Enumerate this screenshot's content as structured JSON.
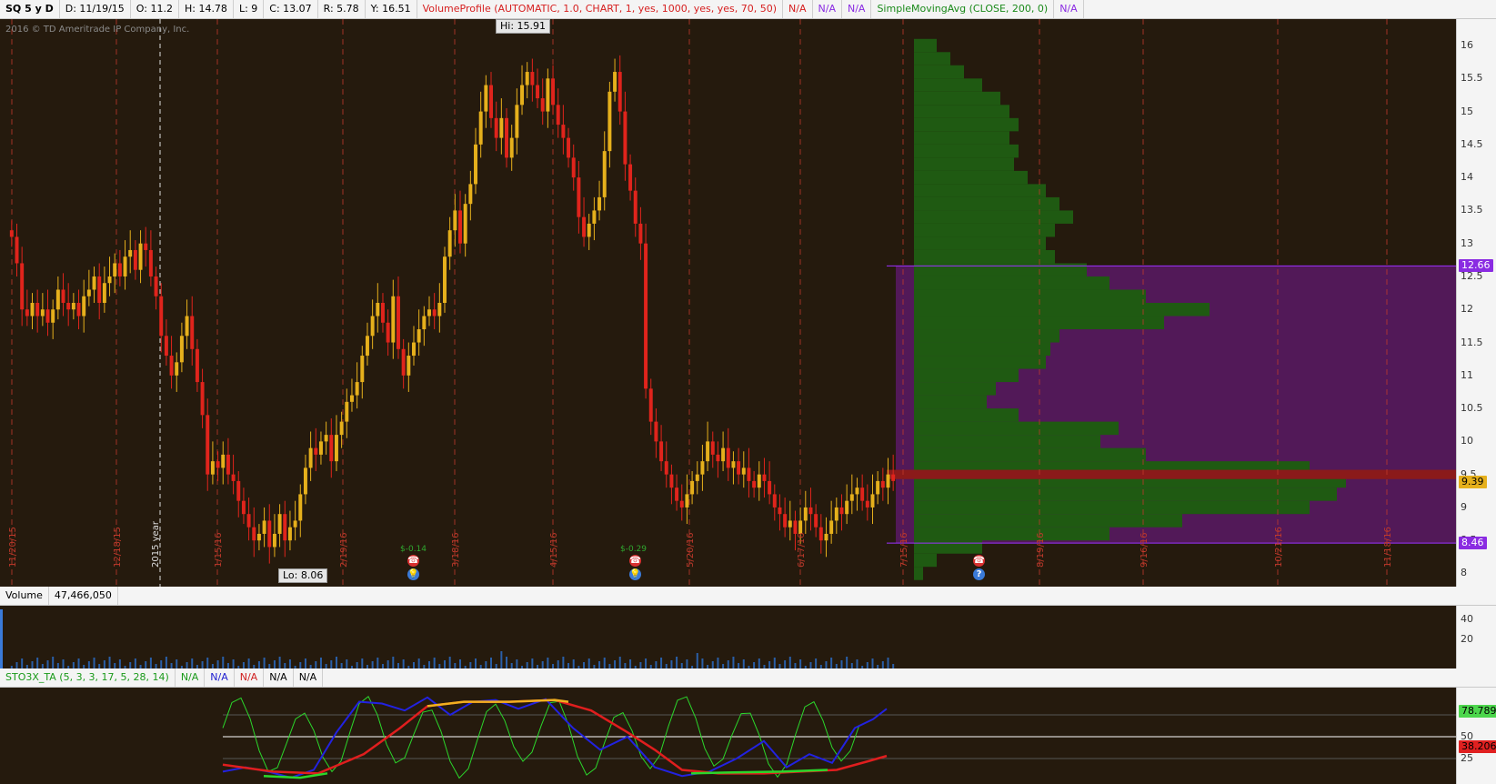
{
  "main_header": {
    "symbol": "SQ 5 y D",
    "date": "D: 11/19/15",
    "open": "O: 11.2",
    "high": "H: 14.78",
    "low": "L: 9",
    "close": "C: 13.07",
    "range": "R: 5.78",
    "year": "Y: 16.51",
    "volume_profile": "VolumeProfile (AUTOMATIC, 1.0, CHART, 1, yes, 1000, yes, yes, 70, 50)",
    "na1": "N/A",
    "na2": "N/A",
    "na3": "N/A",
    "sma": "SimpleMovingAvg (CLOSE, 200, 0)",
    "na4": "N/A"
  },
  "watermark": "2016 © TD Ameritrade IP Company, Inc.",
  "annotations": {
    "hi": "Hi: 15.91",
    "lo": "Lo: 8.06",
    "year_marker": "2015 year"
  },
  "event_labels": {
    "e1": "$-0.14",
    "e2": "$-0.29"
  },
  "volume_header": {
    "label": "Volume",
    "value": "47,466,050"
  },
  "sto_header": {
    "label": "STO3X_TA (5, 3, 3, 17, 5, 28, 14)",
    "na1": "N/A",
    "na2": "N/A",
    "na3": "N/A",
    "na4": "N/A",
    "na5": "N/A"
  },
  "price_axis": {
    "ticks": [
      "16",
      "15.5",
      "15",
      "14.5",
      "14",
      "13.5",
      "13",
      "12.5",
      "12",
      "11.5",
      "11",
      "10.5",
      "10",
      "9.5",
      "9",
      "8.5",
      "8"
    ],
    "badges": {
      "high": "12.66",
      "current": "9.39",
      "low": "8.46"
    }
  },
  "volume_axis": {
    "ticks": [
      "40",
      "20"
    ]
  },
  "sto_axis": {
    "ticks": [
      "75",
      "50",
      "25"
    ],
    "badges": {
      "blue": "78.7897",
      "red": "38.2067"
    }
  },
  "dates": [
    "11/20/15",
    "12/18/15",
    "1/15/16",
    "2/19/16",
    "3/18/16",
    "4/15/16",
    "5/20/16",
    "6/17/16",
    "7/15/16",
    "8/19/16",
    "9/16/16",
    "10/21/16",
    "11/18/16"
  ],
  "colors": {
    "up": "#e6b01c",
    "down": "#e0241c",
    "grid": "#c0392b",
    "profile": "#1f5a12",
    "value_area": "#5a1a66",
    "poc": "#8b1a1a",
    "sto_green": "#2bd62b",
    "sto_blue": "#2222e0",
    "sto_red": "#e01e1e",
    "sto_yellow": "#f0b020"
  },
  "chart_data": {
    "type": "candlestick",
    "title": "SQ 5 y D",
    "ylim": [
      7.8,
      16.4
    ],
    "closes": [
      13.1,
      12.7,
      12.0,
      11.9,
      12.1,
      11.9,
      12.0,
      11.8,
      12.0,
      12.3,
      12.1,
      12.0,
      12.1,
      11.9,
      12.2,
      12.3,
      12.5,
      12.1,
      12.4,
      12.5,
      12.7,
      12.5,
      12.8,
      12.9,
      12.6,
      13.0,
      12.9,
      12.5,
      12.2,
      11.6,
      11.3,
      11.0,
      11.2,
      11.6,
      11.9,
      11.4,
      10.9,
      10.4,
      9.5,
      9.7,
      9.6,
      9.8,
      9.5,
      9.4,
      9.1,
      8.9,
      8.7,
      8.5,
      8.6,
      8.8,
      8.4,
      8.6,
      8.9,
      8.5,
      8.7,
      8.8,
      9.2,
      9.6,
      9.9,
      9.8,
      10.0,
      10.1,
      9.7,
      10.1,
      10.3,
      10.6,
      10.7,
      10.9,
      11.3,
      11.6,
      11.9,
      12.1,
      11.8,
      11.5,
      12.2,
      11.4,
      11.0,
      11.3,
      11.5,
      11.7,
      11.9,
      12.0,
      11.9,
      12.1,
      12.8,
      13.2,
      13.5,
      13.0,
      13.6,
      13.9,
      14.5,
      15.0,
      15.4,
      14.9,
      14.6,
      14.9,
      14.3,
      14.6,
      15.1,
      15.4,
      15.6,
      15.4,
      15.2,
      15.0,
      15.5,
      15.1,
      14.8,
      14.6,
      14.3,
      14.0,
      13.4,
      13.1,
      13.3,
      13.5,
      13.7,
      14.4,
      15.3,
      15.6,
      15.0,
      14.2,
      13.8,
      13.3,
      13.0,
      10.8,
      10.3,
      10.0,
      9.7,
      9.5,
      9.3,
      9.1,
      9.0,
      9.2,
      9.4,
      9.5,
      9.7,
      10.0,
      9.8,
      9.7,
      9.9,
      9.6,
      9.7,
      9.5,
      9.6,
      9.4,
      9.3,
      9.5,
      9.4,
      9.2,
      9.0,
      8.9,
      8.7,
      8.8,
      8.6,
      8.8,
      9.0,
      8.9,
      8.7,
      8.5,
      8.6,
      8.8,
      9.0,
      8.9,
      9.1,
      9.2,
      9.3,
      9.1,
      9.0,
      9.2,
      9.4,
      9.3,
      9.5,
      9.4
    ]
  }
}
